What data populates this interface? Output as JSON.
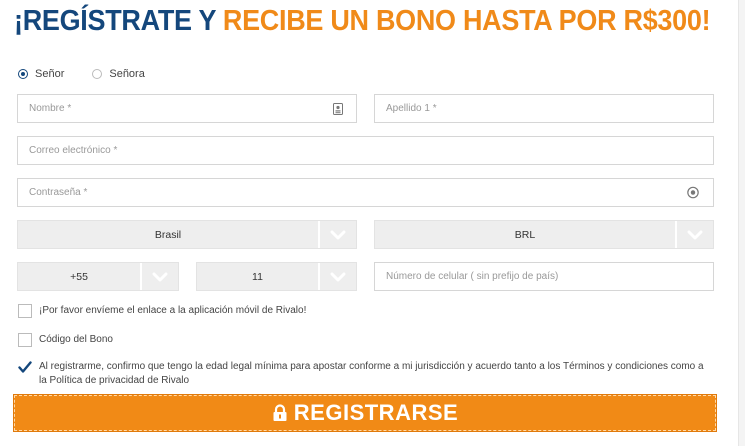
{
  "headline": {
    "part1": "¡REGÍSTRATE Y ",
    "part2": "RECIBE UN BONO HASTA POR R$300!",
    "color_primary": "#14477c",
    "color_accent": "#f08a19"
  },
  "gender": {
    "options": [
      "Señor",
      "Señora"
    ],
    "selected": "Señor"
  },
  "fields": {
    "nombre_placeholder": "Nombre *",
    "nombre_icon": "id-card-icon",
    "apellido_placeholder": "Apellido 1 *",
    "correo_placeholder": "Correo electrónico *",
    "contrasena_placeholder": "Contraseña *",
    "contrasena_icon": "eye-icon",
    "celular_placeholder": "Número de celular ( sin prefijo de país)"
  },
  "selects": {
    "country": "Brasil",
    "currency": "BRL",
    "phone_prefix": "+55",
    "area_code": "11"
  },
  "checkboxes": {
    "app_link": {
      "label": "¡Por favor envíeme el enlace a la aplicación móvil de Rivalo!",
      "checked": false
    },
    "bonus_code": {
      "label": "Código del Bono",
      "checked": false
    },
    "terms": {
      "label": "Al registrarme, confirmo que tengo la edad legal mínima para apostar conforme a mi jurisdicción y acuerdo tanto a los Términos y condiciones como a la Política de privacidad de Rivalo",
      "checked": true
    }
  },
  "register_button": {
    "label": "REGISTRARSE",
    "icon": "lock-icon",
    "color": "#f18a16"
  }
}
